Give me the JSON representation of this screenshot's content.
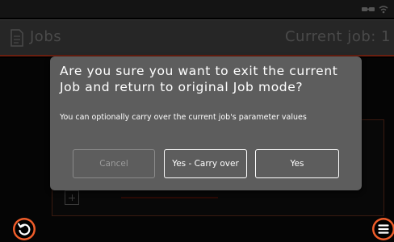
{
  "header": {
    "title": "Jobs",
    "current_job": "Current job: 1",
    "icon": "document-icon"
  },
  "status_bar": {
    "icons": [
      "network-icon",
      "wifi-icon"
    ]
  },
  "dialog": {
    "title": "Are you sure you want to exit the current Job and return to original Job mode?",
    "message": "You can optionally carry over the current job's parameter values",
    "buttons": {
      "cancel": "Cancel",
      "carry_over": "Yes - Carry over",
      "yes": "Yes"
    }
  },
  "footer": {
    "back_icon": "back-icon",
    "menu_icon": "menu-icon"
  },
  "colors": {
    "accent": "#ef5d2a",
    "dialog_bg": "#5d5d5d",
    "header_bg": "#262626",
    "header_border": "#6a1f10",
    "disabled_text": "#9c9c9c"
  }
}
